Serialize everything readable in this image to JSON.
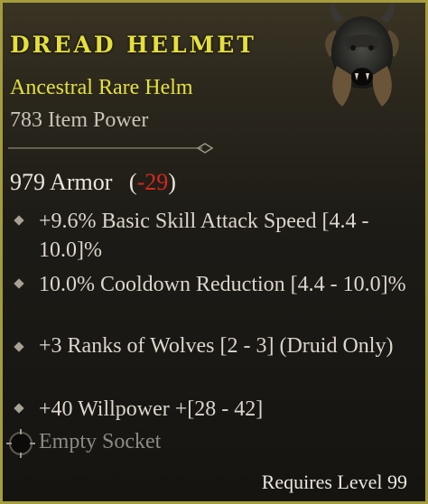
{
  "item": {
    "name": "DREAD HELMET",
    "type": "Ancestral Rare Helm",
    "power": "783 Item Power",
    "armor_value": "979 Armor",
    "armor_open": "(",
    "armor_delta": "-29",
    "armor_close": ")",
    "affixes": [
      "+9.6% Basic Skill Attack Speed [4.4 - 10.0]%",
      "10.0% Cooldown Reduction [4.4 - 10.0]%",
      "+3 Ranks of Wolves [2 - 3] (Druid Only)",
      "+40 Willpower +[28 - 42]"
    ],
    "socket": "Empty Socket",
    "requirement": "Requires Level 99"
  },
  "colors": {
    "border": "#a59c3c",
    "title": "#e5df3b",
    "rarity": "#e3e03f",
    "negative": "#d12a1f"
  },
  "icons": {
    "item": "horned-helmet-icon",
    "bullet": "diamond-bullet-icon",
    "socket": "empty-socket-icon",
    "divider": "ornamental-divider"
  }
}
